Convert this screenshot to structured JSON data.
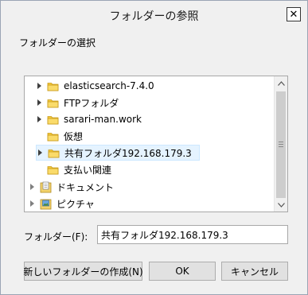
{
  "window": {
    "title": "フォルダーの参照",
    "close_glyph": "✕"
  },
  "instruction": "フォルダーの選択",
  "tree": {
    "items": [
      {
        "label": "elasticsearch-7.4.0",
        "expandable": true,
        "selected": false,
        "icon": "folder-icon"
      },
      {
        "label": "FTPフォルダ",
        "expandable": true,
        "selected": false,
        "icon": "folder-icon"
      },
      {
        "label": "sarari-man.work",
        "expandable": true,
        "selected": false,
        "icon": "folder-icon"
      },
      {
        "label": "仮想",
        "expandable": false,
        "selected": false,
        "icon": "folder-icon"
      },
      {
        "label": "共有フォルダ192.168.179.3",
        "expandable": true,
        "selected": true,
        "icon": "folder-icon"
      },
      {
        "label": "支払い関連",
        "expandable": false,
        "selected": false,
        "icon": "folder-icon"
      },
      {
        "label": "ドキュメント",
        "expandable": true,
        "selected": false,
        "icon": "documents-library-icon"
      },
      {
        "label": "ピクチャ",
        "expandable": true,
        "selected": false,
        "icon": "pictures-library-icon"
      }
    ]
  },
  "folder_field": {
    "label": "フォルダー(F):",
    "value": "共有フォルダ192.168.179.3"
  },
  "buttons": {
    "new_folder": "新しいフォルダーの作成(N)",
    "ok": "OK",
    "cancel": "キャンセル"
  },
  "colors": {
    "folder": "#f5c93a",
    "selection_bg": "#e5f3ff",
    "selection_border": "#cce8ff"
  }
}
